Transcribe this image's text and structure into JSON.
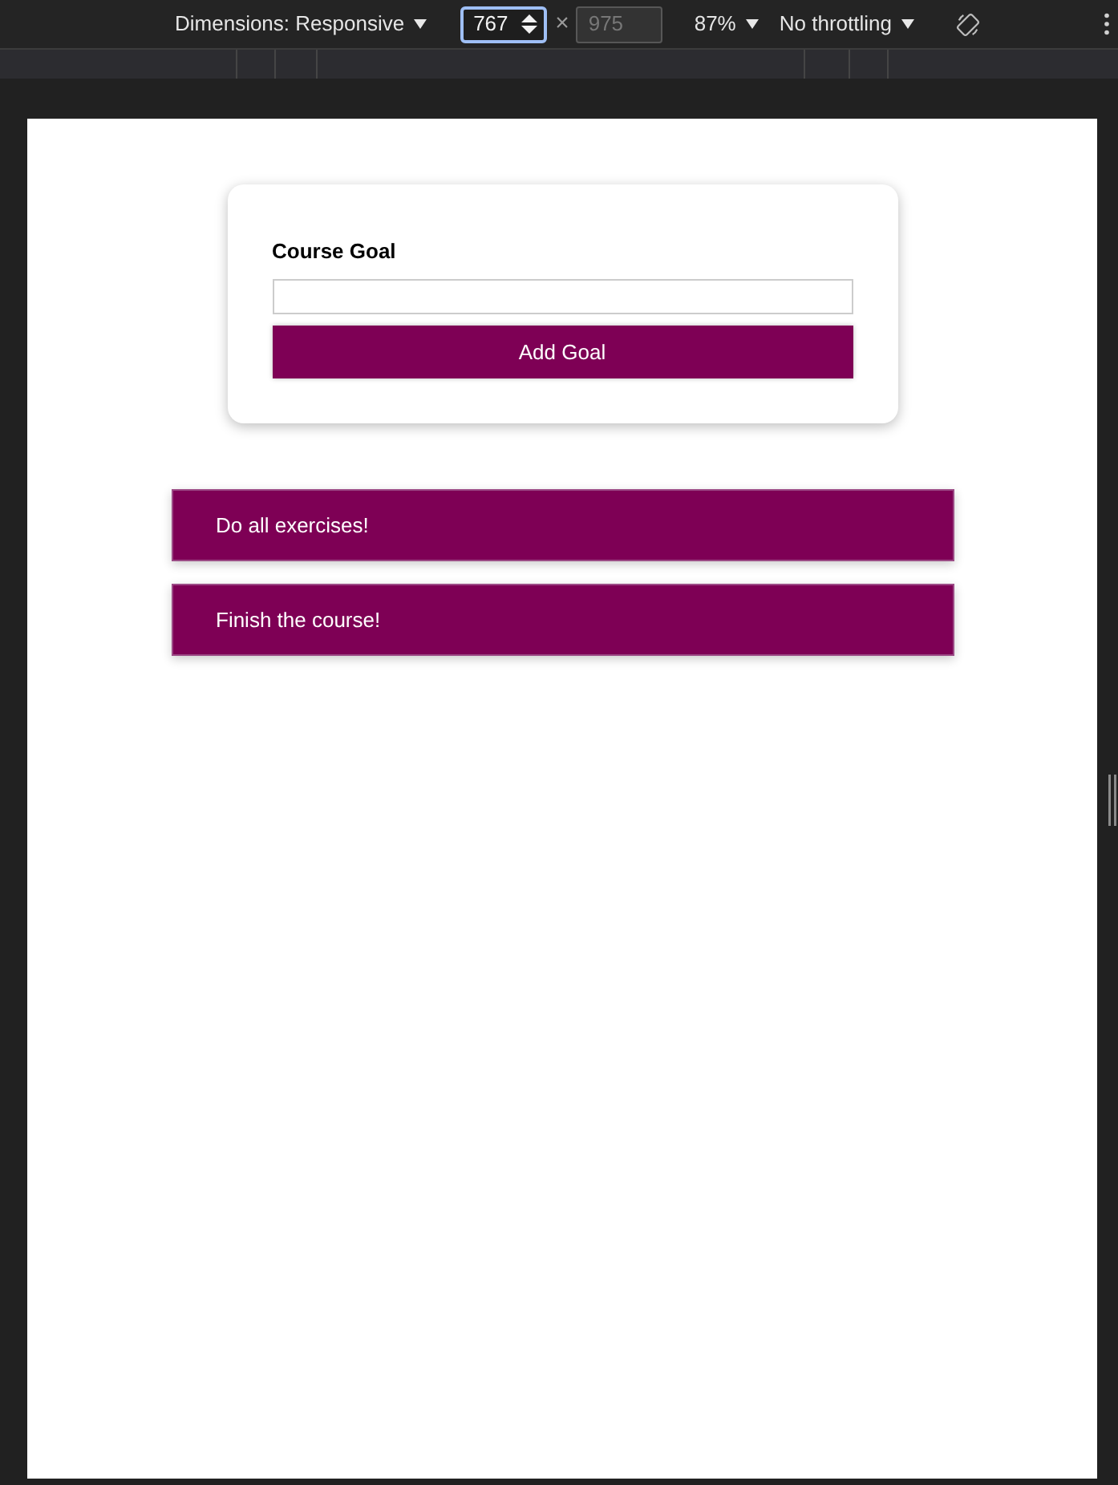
{
  "devtools_toolbar": {
    "dimensions": "Dimensions: Responsive",
    "width": {
      "value": "767",
      "focused": true
    },
    "times": "×",
    "height": {
      "value": "975",
      "disabled": true
    },
    "zoom": "87%",
    "throttling": "No throttling"
  },
  "page": {
    "form": {
      "label": "Course Goal",
      "button": "Add Goal"
    },
    "goals": [
      {
        "text": "Do all exercises!"
      },
      {
        "text": "Finish the course!"
      }
    ]
  }
}
